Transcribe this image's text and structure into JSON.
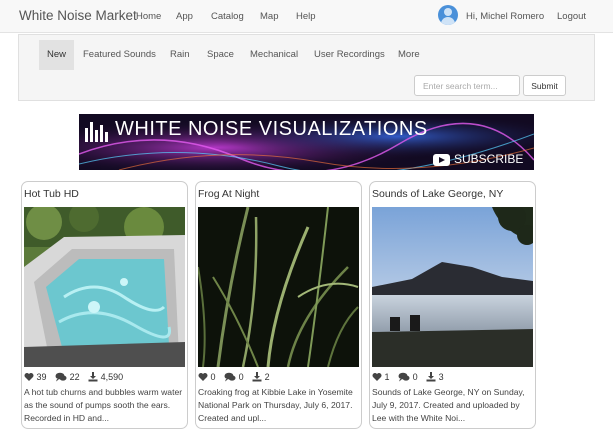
{
  "navbar": {
    "brand": "White Noise Market",
    "links": [
      "Home",
      "App",
      "Catalog",
      "Map",
      "Help"
    ],
    "user_name": "Hi, Michel Romero",
    "logout": "Logout"
  },
  "subnav": {
    "tabs": [
      "New",
      "Featured Sounds",
      "Rain",
      "Space",
      "Mechanical",
      "User Recordings",
      "More"
    ],
    "active_tab": "New",
    "search_placeholder": "Enter search term...",
    "submit_label": "Submit"
  },
  "banner": {
    "title": "WHITE NOISE VISUALIZATIONS",
    "subscribe": "SUBSCRIBE"
  },
  "cards": [
    {
      "title": "Hot Tub HD",
      "likes": "39",
      "comments": "22",
      "downloads": "4,590",
      "description": "A hot tub churns and bubbles warm water as the sound of pumps sooth the ears. Recorded in HD and..."
    },
    {
      "title": "Frog At Night",
      "likes": "0",
      "comments": "0",
      "downloads": "2",
      "description": "Croaking frog at Kibbie Lake in Yosemite National Park on Thursday, July 6, 2017. Created and upl..."
    },
    {
      "title": "Sounds of Lake George, NY",
      "likes": "1",
      "comments": "0",
      "downloads": "3",
      "description": "Sounds of Lake George, NY on Sunday, July 9, 2017. Created and uploaded by Lee with the White Noi..."
    }
  ],
  "icons": {
    "like": "heart-icon",
    "comment": "comments-icon",
    "download": "download-icon",
    "user": "user-avatar-icon",
    "play": "youtube-icon"
  },
  "colors": {
    "navbar_bg": "#f8f8f8",
    "banner_bg": "#120a22",
    "avatar": "#4a90d9"
  }
}
